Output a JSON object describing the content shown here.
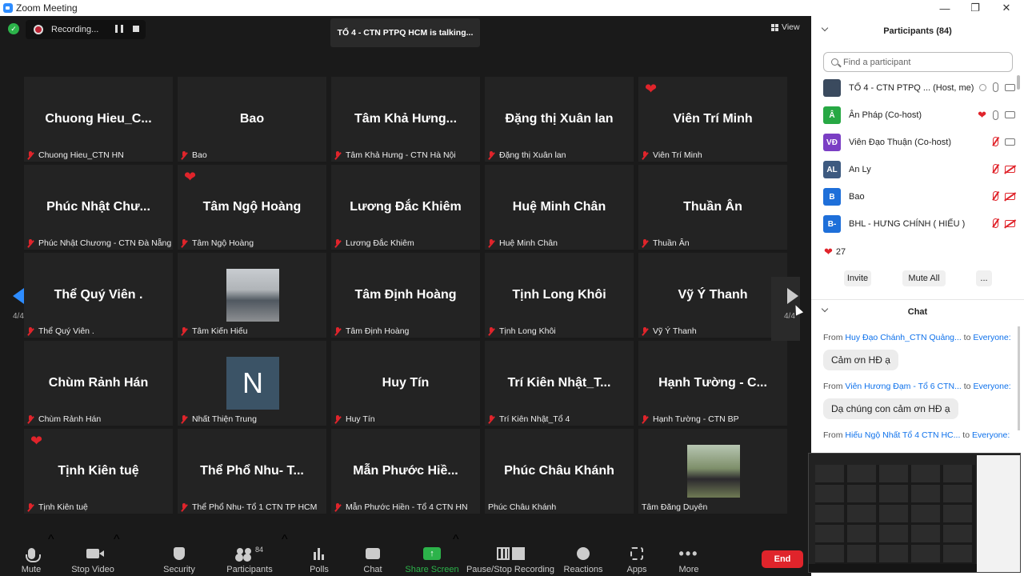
{
  "window": {
    "title": "Zoom Meeting",
    "minimize_icon": "—",
    "maximize_icon": "❐",
    "close_icon": "✕"
  },
  "meeting": {
    "recording_label": "Recording...",
    "talking_banner": "TỔ 4 - CTN PTPQ HCM is talking...",
    "view_label": "View",
    "page_left": "4/4",
    "page_right": "4/4"
  },
  "tiles": [
    {
      "display": "Chuong Hieu_C...",
      "name": "Chuong Hieu_CTN HN",
      "muted": true
    },
    {
      "display": "Bao",
      "name": "Bao",
      "muted": true
    },
    {
      "display": "Tâm Khả Hưng...",
      "name": "Tâm Khả Hưng - CTN Hà Nội",
      "muted": true
    },
    {
      "display": "Đặng thị Xuân lan",
      "name": "Đặng thị Xuân lan",
      "muted": true
    },
    {
      "display": "Viên Trí Minh",
      "name": "Viên Trí Minh",
      "muted": true,
      "heart": true
    },
    {
      "display": "Phúc Nhật Chư...",
      "name": "Phúc Nhật Chương - CTN Đà Nẵng",
      "muted": true
    },
    {
      "display": "Tâm Ngộ Hoàng",
      "name": "Tâm Ngộ Hoàng",
      "muted": true,
      "heart": true
    },
    {
      "display": "Lương Đắc Khiêm",
      "name": "Lương Đắc Khiêm",
      "muted": true
    },
    {
      "display": "Huệ Minh Chân",
      "name": "Huệ Minh Chân",
      "muted": true
    },
    {
      "display": "Thuần Ân",
      "name": "Thuần Ân",
      "muted": true
    },
    {
      "display": "Thể Quý Viên .",
      "name": "Thể Quý Viên .",
      "muted": true
    },
    {
      "display": "",
      "name": "Tâm Kiến Hiếu",
      "muted": true,
      "photo": "a"
    },
    {
      "display": "Tâm Định Hoàng",
      "name": "Tâm Định Hoàng",
      "muted": true
    },
    {
      "display": "Tịnh Long Khôi",
      "name": "Tịnh Long Khôi",
      "muted": true
    },
    {
      "display": "Vỹ Ý Thanh",
      "name": "Vỹ Ý Thanh",
      "muted": true
    },
    {
      "display": "Chùm Rảnh Hán",
      "name": "Chùm Rảnh Hán",
      "muted": true
    },
    {
      "display": "N",
      "name": "Nhất Thiện Trung",
      "muted": true,
      "photo": "b"
    },
    {
      "display": "Huy Tín",
      "name": "Huy Tín",
      "muted": true
    },
    {
      "display": "Trí Kiên Nhật_T...",
      "name": "Trí Kiên Nhật_Tổ 4",
      "muted": true
    },
    {
      "display": "Hạnh Tường - C...",
      "name": "Hạnh Tường - CTN BP",
      "muted": true
    },
    {
      "display": "Tịnh Kiên tuệ",
      "name": "Tịnh Kiên tuệ",
      "muted": true,
      "heart": true
    },
    {
      "display": "Thể Phổ Nhu- T...",
      "name": "Thể Phổ Nhu- Tổ 1 CTN TP HCM",
      "muted": true
    },
    {
      "display": "Mẫn Phước Hiề...",
      "name": "Mẫn Phước Hiền - Tổ 4 CTN HN",
      "muted": true
    },
    {
      "display": "Phúc Châu Khánh",
      "name": "Phúc Châu Khánh",
      "muted": false
    },
    {
      "display": "",
      "name": "Tâm Đăng Duyên",
      "muted": false,
      "photo": "c"
    }
  ],
  "toolbar": {
    "mute": "Mute",
    "stop_video": "Stop Video",
    "security": "Security",
    "participants": "Participants",
    "participants_count": "84",
    "polls": "Polls",
    "chat": "Chat",
    "share_screen": "Share Screen",
    "pause_stop_recording": "Pause/Stop Recording",
    "reactions": "Reactions",
    "apps": "Apps",
    "more": "More",
    "end": "End",
    "caret": "^",
    "share_arrow": "↑",
    "more_dots": "•••"
  },
  "participants_panel": {
    "title": "Participants (84)",
    "search_placeholder": "Find a participant",
    "rows": [
      {
        "initials": "",
        "name": "TỔ 4 - CTN PTPQ ...  (Host, me)",
        "color": "#3a4a5e"
      },
      {
        "initials": "Â",
        "name": "Ân Pháp (Co-host)",
        "color": "#27a844"
      },
      {
        "initials": "VĐ",
        "name": "Viên Đạo Thuận (Co-host)",
        "color": "#7b3fc4"
      },
      {
        "initials": "AL",
        "name": "An Ly",
        "color": "#3d5a80"
      },
      {
        "initials": "B",
        "name": "Bao",
        "color": "#1e6fd9"
      },
      {
        "initials": "B-",
        "name": "BHL - HƯNG CHÍNH ( HIẾU )",
        "color": "#1e6fd9"
      }
    ],
    "reaction_count": "27",
    "heart": "❤",
    "invite": "Invite",
    "mute_all": "Mute All",
    "more": "..."
  },
  "chat_panel": {
    "title": "Chat",
    "from_word": "From",
    "to_word": "to",
    "messages": [
      {
        "from": "Huy Đạo Chánh_CTN Quảng...",
        "to": "Everyone:",
        "text": "Cảm ơn HĐ ạ"
      },
      {
        "from": "Viên Hương Đạm - Tổ 6 CTN...",
        "to": "Everyone:",
        "text": "Dạ chúng con cảm ơn HĐ ạ"
      },
      {
        "from": "Hiếu Ngộ Nhất Tổ 4 CTN HC...",
        "to": "Everyone:",
        "text": ""
      }
    ]
  }
}
